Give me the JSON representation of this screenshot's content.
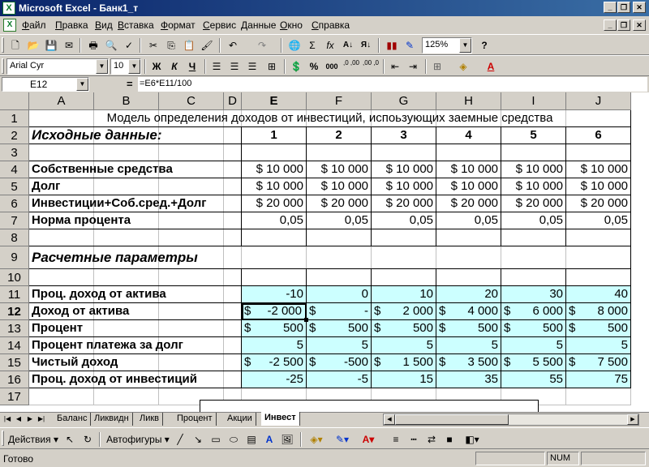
{
  "window": {
    "title": "Microsoft Excel - Банк1_т",
    "app_icon": "excel-icon",
    "min": "_",
    "restore": "❐",
    "close": "✕"
  },
  "menu": {
    "items": [
      "Файл",
      "Правка",
      "Вид",
      "Вставка",
      "Формат",
      "Сервис",
      "Данные",
      "Окно",
      "Справка"
    ]
  },
  "toolbar": {
    "zoom": "125%",
    "font_name": "Arial Cyr",
    "font_size": "10",
    "bold": "Ж",
    "italic": "К",
    "underline": "Ч",
    "percent": "%",
    "thousands": "000",
    "inc_dec": ",0 ,00",
    "dec_dec": ",00 ,0",
    "sum": "Σ",
    "fx": "fx"
  },
  "formula_bar": {
    "name_box": "E12",
    "equals": "=",
    "formula": "=E6*E11/100"
  },
  "columns": [
    "A",
    "B",
    "C",
    "D",
    "E",
    "F",
    "G",
    "H",
    "I",
    "J"
  ],
  "rows": [
    "1",
    "2",
    "3",
    "4",
    "5",
    "6",
    "7",
    "8",
    "9",
    "10",
    "11",
    "12",
    "13",
    "14",
    "15",
    "16",
    "17"
  ],
  "sheet": {
    "title": "Модель определения доходов от инвестиций, испоьзующих заемные средства",
    "section1": "Исходные данные:",
    "section2": "Расчетные параметры",
    "periods": [
      "1",
      "2",
      "3",
      "4",
      "5",
      "6"
    ],
    "labels": {
      "r4": "Собственные средства",
      "r5": "Долг",
      "r6": "Инвестиции+Соб.сред.+Долг",
      "r7": "Норма процента",
      "r11": "Проц. доход от актива",
      "r12": "Доход от актива",
      "r13": "Процент",
      "r14": "Процент платежа за долг",
      "r15": "Чистый доход",
      "r16": "Проц. доход от инвестиций"
    },
    "r4": [
      "$ 10 000",
      "$ 10 000",
      "$ 10 000",
      "$ 10 000",
      "$ 10 000",
      "$ 10 000"
    ],
    "r5": [
      "$ 10 000",
      "$ 10 000",
      "$ 10 000",
      "$ 10 000",
      "$ 10 000",
      "$ 10 000"
    ],
    "r6": [
      "$ 20 000",
      "$ 20 000",
      "$ 20 000",
      "$ 20 000",
      "$ 20 000",
      "$ 20 000"
    ],
    "r7": [
      "0,05",
      "0,05",
      "0,05",
      "0,05",
      "0,05",
      "0,05"
    ],
    "r11": [
      "-10",
      "0",
      "10",
      "20",
      "30",
      "40"
    ],
    "r12": [
      [
        "$",
        "-2 000"
      ],
      [
        "$",
        "-"
      ],
      [
        "$",
        "2 000"
      ],
      [
        "$",
        "4 000"
      ],
      [
        "$",
        "6 000"
      ],
      [
        "$",
        "8 000"
      ]
    ],
    "r13": [
      [
        "$",
        "500"
      ],
      [
        "$",
        "500"
      ],
      [
        "$",
        "500"
      ],
      [
        "$",
        "500"
      ],
      [
        "$",
        "500"
      ],
      [
        "$",
        "500"
      ]
    ],
    "r14": [
      "5",
      "5",
      "5",
      "5",
      "5",
      "5"
    ],
    "r15": [
      [
        "$",
        "-2 500"
      ],
      [
        "$",
        "-500"
      ],
      [
        "$",
        "1 500"
      ],
      [
        "$",
        "3 500"
      ],
      [
        "$",
        "5 500"
      ],
      [
        "$",
        "7 500"
      ]
    ],
    "r16": [
      "-25",
      "-5",
      "15",
      "35",
      "55",
      "75"
    ]
  },
  "tabs": [
    "Баланс",
    "Ликвидн",
    "Ликв",
    "Процент",
    "Акции",
    "Инвест"
  ],
  "active_tab": "Инвест",
  "drawing": {
    "actions": "Действия",
    "autoshapes": "Автофигуры"
  },
  "status": {
    "text": "Готово",
    "num": "NUM"
  },
  "colors": {
    "title_bar": "#0a246a",
    "cell_fill": "#ccffff",
    "chrome": "#d4d0c8"
  }
}
